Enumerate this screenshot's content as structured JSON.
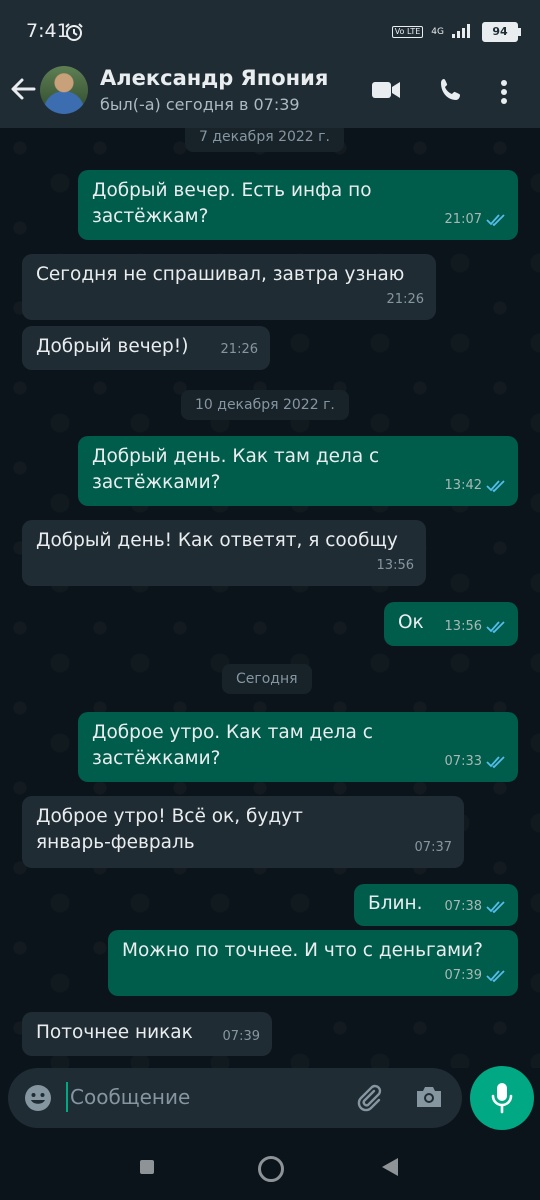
{
  "status_bar": {
    "time": "7:41",
    "network": "4G",
    "volte": "Vo LTE",
    "battery": "94"
  },
  "header": {
    "contact_name": "Александр Япония",
    "contact_status": "был(-а) сегодня в 07:39"
  },
  "dates": [
    "7 декабря 2022 г.",
    "10 декабря 2022 г.",
    "Сегодня"
  ],
  "messages": [
    {
      "direction": "out",
      "text": "Добрый вечер. Есть инфа по\nзастёжкам?",
      "time": "21:07",
      "read": true
    },
    {
      "direction": "in",
      "text": "Сегодня не спрашивал, завтра узнаю",
      "time": "21:26"
    },
    {
      "direction": "in",
      "text": "Добрый вечер!)",
      "time": "21:26"
    },
    {
      "direction": "out",
      "text": "Добрый день. Как там дела с\nзастёжками?",
      "time": "13:42",
      "read": true
    },
    {
      "direction": "in",
      "text": "Добрый день! Как ответят, я сообщу",
      "time": "13:56"
    },
    {
      "direction": "out",
      "text": "Ок",
      "time": "13:56",
      "read": true
    },
    {
      "direction": "out",
      "text": "Доброе утро. Как там дела с\nзастёжками?",
      "time": "07:33",
      "read": true
    },
    {
      "direction": "in",
      "text": "Доброе утро! Всё ок, будут\nянварь-февраль",
      "time": "07:37"
    },
    {
      "direction": "out",
      "text": "Блин.",
      "time": "07:38",
      "read": true
    },
    {
      "direction": "out",
      "text": "Можно по точнее. И что с деньгами?",
      "time": "07:39",
      "read": true
    },
    {
      "direction": "in",
      "text": "Поточнее никак",
      "time": "07:39"
    }
  ],
  "composer": {
    "placeholder": "Сообщение"
  },
  "colors": {
    "outgoing": "#005c4b",
    "incoming": "#202c33",
    "accent": "#00a884",
    "read_ticks": "#53bdeb"
  }
}
